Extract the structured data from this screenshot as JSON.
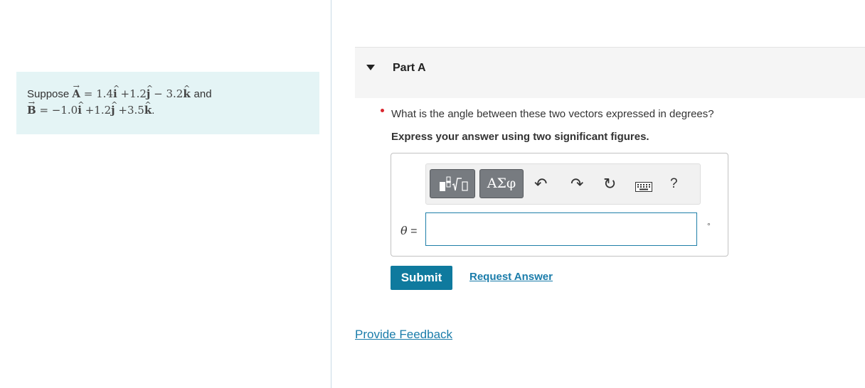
{
  "problem": {
    "suppose": "Suppose",
    "and": "and",
    "A": {
      "symbol": "A",
      "c1": "1.4",
      "u1": "i",
      "op2": "+",
      "c2": "1.2",
      "u2": "j",
      "op3": "−",
      "c3": "3.2",
      "u3": "k"
    },
    "B": {
      "symbol": "B",
      "c1": "−1.0",
      "u1": "i",
      "op2": "+",
      "c2": "1.2",
      "u2": "j",
      "op3": "+",
      "c3": "3.5",
      "u3": "k"
    },
    "period": "."
  },
  "part": {
    "title": "Part A",
    "question": "What is the angle between these two vectors expressed in degrees?",
    "instruction": "Express your answer using two significant figures."
  },
  "toolbar": {
    "templates_icon": "templates-icon",
    "greek_label": "ΑΣφ",
    "undo_icon": "↶",
    "redo_icon": "↷",
    "reset_icon": "↻",
    "keyboard_icon": "keyboard-icon",
    "help_label": "?"
  },
  "answer": {
    "variable": "θ",
    "equals": "=",
    "value": "",
    "unit": "°"
  },
  "actions": {
    "submit_label": "Submit",
    "request_label": "Request Answer",
    "feedback_label": "Provide Feedback"
  },
  "colors": {
    "problem_bg": "#e4f4f5",
    "submit_bg": "#0f7a9e",
    "link": "#1a7caa",
    "bullet": "#d9262e",
    "input_border": "#1f7fa8"
  }
}
